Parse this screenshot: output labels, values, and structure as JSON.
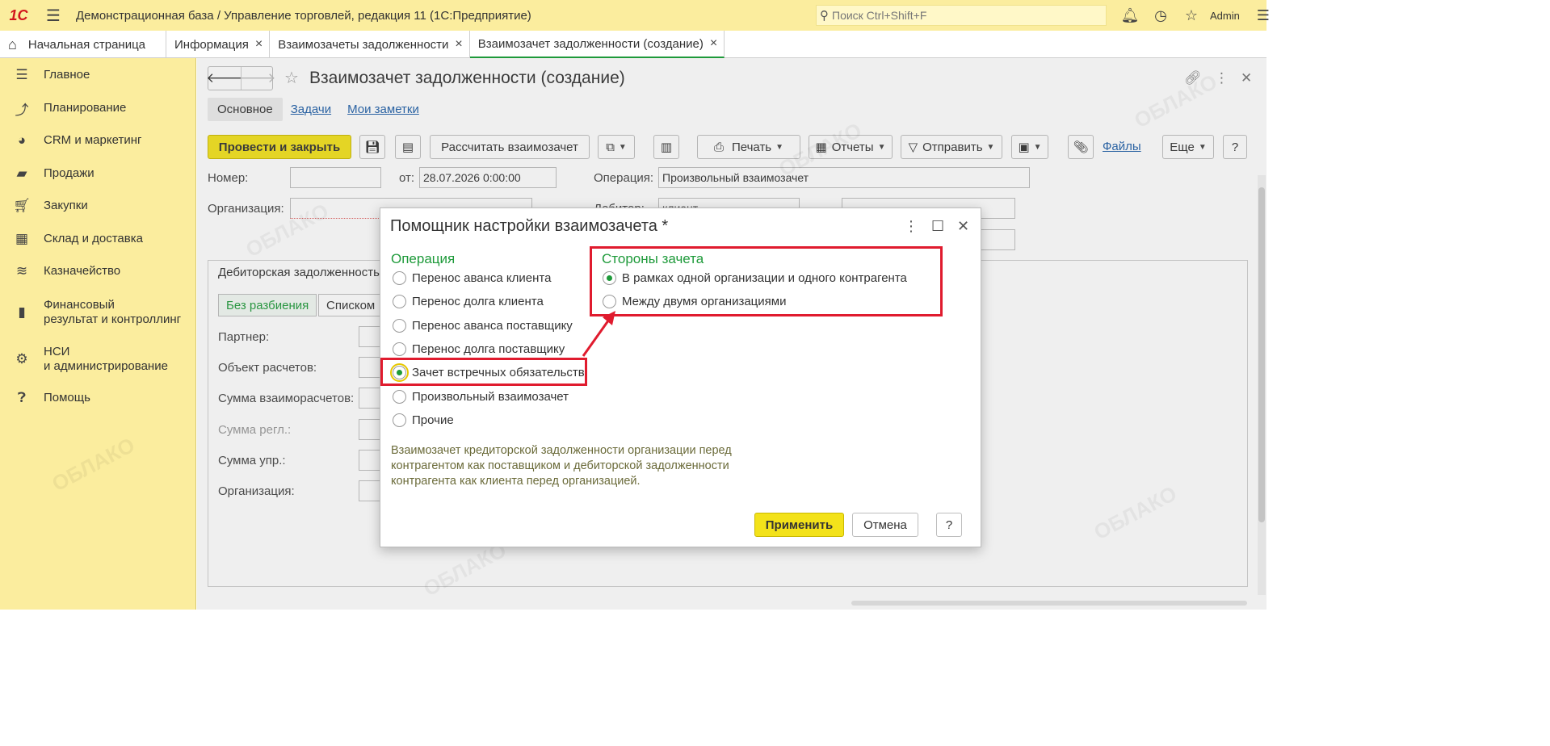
{
  "topbar": {
    "logo": "1С",
    "title": "Демонстрационная база / Управление торговлей, редакция 11  (1С:Предприятие)",
    "search_placeholder": "Поиск Ctrl+Shift+F",
    "user": "Admin"
  },
  "tabs": [
    {
      "label": "Начальная страница"
    },
    {
      "label": "Информация"
    },
    {
      "label": "Взаимозачеты задолженности"
    },
    {
      "label": "Взаимозачет задолженности (создание)"
    }
  ],
  "sidebar": {
    "items": [
      {
        "label": "Главное",
        "icon": "menu-icon"
      },
      {
        "label": "Планирование",
        "icon": "planning-icon"
      },
      {
        "label": "CRM и маркетинг",
        "icon": "pie-chart-icon"
      },
      {
        "label": "Продажи",
        "icon": "bag-icon"
      },
      {
        "label": "Закупки",
        "icon": "cart-icon"
      },
      {
        "label": "Склад и доставка",
        "icon": "warehouse-icon"
      },
      {
        "label": "Казначейство",
        "icon": "coins-icon"
      },
      {
        "label": "Финансовый",
        "label2": "результат и контроллинг",
        "icon": "bar-chart-icon"
      },
      {
        "label": "НСИ",
        "label2": "и администрирование",
        "icon": "gear-icon"
      },
      {
        "label": "Помощь",
        "icon": "help-icon"
      }
    ]
  },
  "form": {
    "title": "Взаимозачет задолженности (создание)",
    "subtabs": {
      "main": "Основное",
      "tasks": "Задачи",
      "notes": "Мои заметки"
    },
    "toolbar": {
      "post_close": "Провести и закрыть",
      "calc": "Рассчитать взаимозачет",
      "print": "Печать",
      "reports": "Отчеты",
      "send": "Отправить",
      "files": "Файлы",
      "more": "Еще",
      "help": "?"
    },
    "number_label": "Номер:",
    "number_value": "",
    "date_label": "от:",
    "date_value": "28.07.2026  0:00:00",
    "operation_label": "Операция:",
    "operation_value": "Произвольный взаимозачет",
    "org_label": "Организация:",
    "debtor_label": "Дебитор:",
    "debtor_value": "клиент",
    "group_tab": "Дебиторская задолженность",
    "seg_active": "Без разбиения",
    "seg_other": "Списком",
    "partner_label": "Партнер:",
    "object_label": "Объект расчетов:",
    "sum_label": "Сумма взаиморасчетов:",
    "sum_reg_label": "Сумма регл.:",
    "sum_upr_label": "Сумма упр.:",
    "org2_label": "Организация:"
  },
  "dialog": {
    "title": "Помощник настройки взаимозачета *",
    "operation_title": "Операция",
    "operations": [
      {
        "label": "Перенос аванса клиента",
        "checked": false
      },
      {
        "label": "Перенос долга клиента",
        "checked": false
      },
      {
        "label": "Перенос аванса поставщику",
        "checked": false
      },
      {
        "label": "Перенос долга поставщику",
        "checked": false
      },
      {
        "label": "Зачет встречных обязательств",
        "checked": true
      },
      {
        "label": "Произвольный взаимозачет",
        "checked": false
      },
      {
        "label": "Прочие",
        "checked": false
      }
    ],
    "sides_title": "Стороны зачета",
    "sides": [
      {
        "label": "В рамках одной организации и одного контрагента",
        "checked": true
      },
      {
        "label": "Между двумя организациями",
        "checked": false
      }
    ],
    "description": "Взаимозачет кредиторской задолженности организации перед контрагентом как поставщиком и дебиторской задолженности контрагента как клиента перед организацией.",
    "apply": "Применить",
    "cancel": "Отмена",
    "help": "?"
  },
  "colors": {
    "accent_yellow": "#f3e21a",
    "panel_yellow": "#fbed9e",
    "green": "#1e9a3a",
    "highlight_red": "#e01b2e"
  },
  "watermark": {
    "text": "ОБЛАКО"
  }
}
